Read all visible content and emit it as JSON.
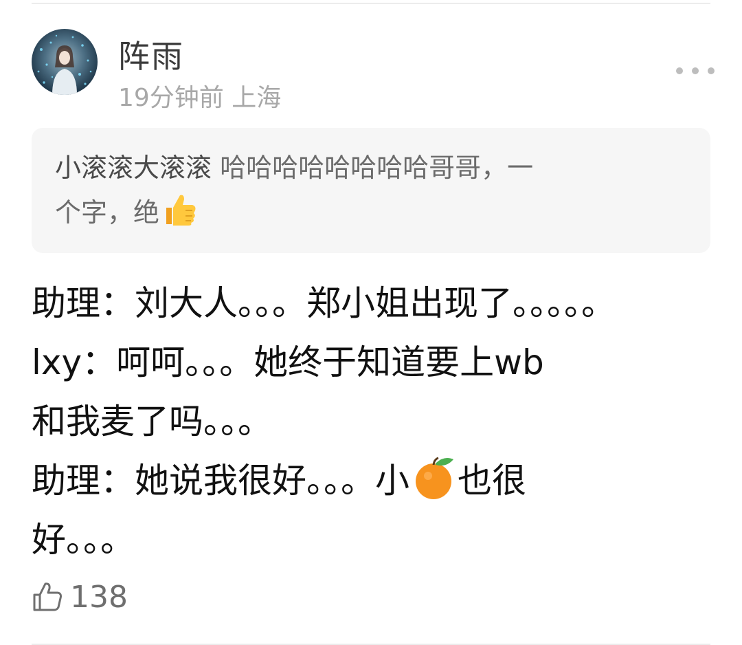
{
  "post": {
    "author": "阵雨",
    "time": "19分钟前",
    "location": "上海",
    "meta": "19分钟前 上海"
  },
  "quote": {
    "name": "小滚滚大滚滚",
    "text_line1": "哈哈哈哈哈哈哈哈哥哥，一",
    "text_line2": "个字，绝",
    "emoji": "thumbs-up"
  },
  "content": {
    "line1": "助理：刘大人。。。郑小姐出现了。。。。。",
    "line2": "lxy：呵呵。。。她终于知道要上wb",
    "line3": "和我麦了吗。。。",
    "line4_before": "助理：她说我很好。。。小",
    "line4_emoji": "tangerine",
    "line4_after": "也很",
    "line5": "好。。。"
  },
  "actions": {
    "like_icon": "thumbs-up-outline-icon",
    "like_count": "138",
    "more_icon": "more-dots-icon"
  },
  "colors": {
    "quote_bg": "#f6f6f6",
    "meta_gray": "#a8a8a8",
    "text_dark": "#111111"
  }
}
